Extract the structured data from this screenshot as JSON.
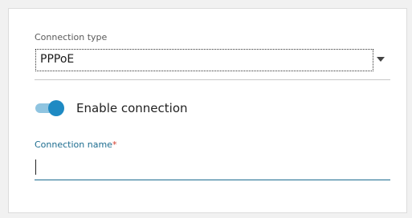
{
  "connection_type": {
    "label": "Connection type",
    "selected": "PPPoE",
    "options": [
      "PPPoE"
    ]
  },
  "enable_connection": {
    "label": "Enable connection",
    "enabled": true
  },
  "connection_name": {
    "label": "Connection name",
    "required_mark": "*",
    "value": "",
    "placeholder": ""
  },
  "colors": {
    "accent": "#1e8ac3",
    "accent_light": "#8fc4e0",
    "label_active": "#1c6c8f",
    "required": "#d23b2c"
  },
  "icons": {
    "dropdown": "chevron-down-icon"
  }
}
